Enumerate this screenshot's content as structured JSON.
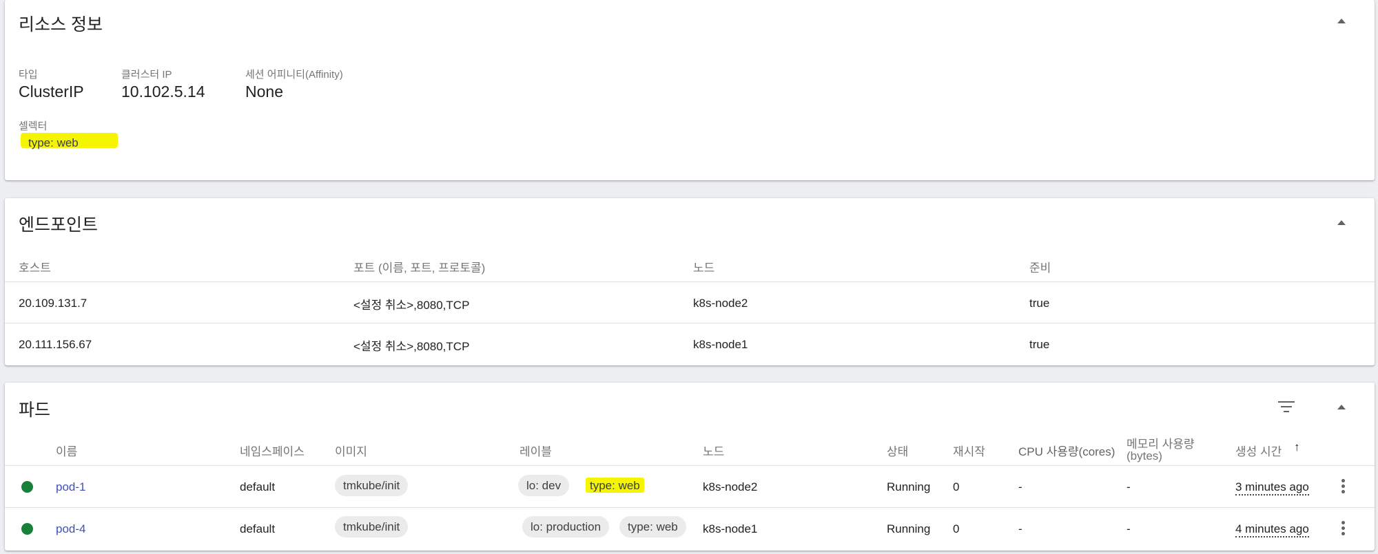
{
  "resource": {
    "title": "리소스 정보",
    "type_label": "타입",
    "type_value": "ClusterIP",
    "cluster_ip_label": "클러스터 IP",
    "cluster_ip_value": "10.102.5.14",
    "affinity_label": "세션 어피니티(Affinity)",
    "affinity_value": "None",
    "selector_label": "셀렉터",
    "selector_chip": "type: web"
  },
  "endpoints": {
    "title": "엔드포인트",
    "headers": [
      "호스트",
      "포트 (이름, 포트, 프로토콜)",
      "노드",
      "준비"
    ],
    "rows": [
      [
        "20.109.131.7",
        "<설정 취소>,8080,TCP",
        "k8s-node2",
        "true"
      ],
      [
        "20.111.156.67",
        "<설정 취소>,8080,TCP",
        "k8s-node1",
        "true"
      ]
    ]
  },
  "pods": {
    "title": "파드",
    "headers": {
      "name": "이름",
      "namespace": "네임스페이스",
      "image": "이미지",
      "labels": "레이블",
      "node": "노드",
      "status": "상태",
      "restarts": "재시작",
      "cpu": "CPU 사용량(cores)",
      "memory": "메모리 사용량",
      "memory_unit": "(bytes)",
      "created": "생성 시간",
      "sort_arrow": "↑"
    },
    "rows": [
      {
        "name": "pod-1",
        "namespace": "default",
        "image": "tmkube/init",
        "label1": "lo: dev",
        "label2": "type: web",
        "node": "k8s-node2",
        "status": "Running",
        "restarts": "0",
        "cpu": "-",
        "memory": "-",
        "created": "3 minutes ago"
      },
      {
        "name": "pod-4",
        "namespace": "default",
        "image": "tmkube/init",
        "label1": "lo: production",
        "label2": "type: web",
        "node": "k8s-node1",
        "status": "Running",
        "restarts": "0",
        "cpu": "-",
        "memory": "-",
        "created": "4 minutes ago"
      }
    ]
  },
  "colors": {
    "running_status": "#188038",
    "link": "#3f51b5",
    "highlight": "#f5f500"
  },
  "icons": [
    "chevron-up-icon",
    "filter-icon",
    "more-vert-icon",
    "arrow-up-icon"
  ]
}
